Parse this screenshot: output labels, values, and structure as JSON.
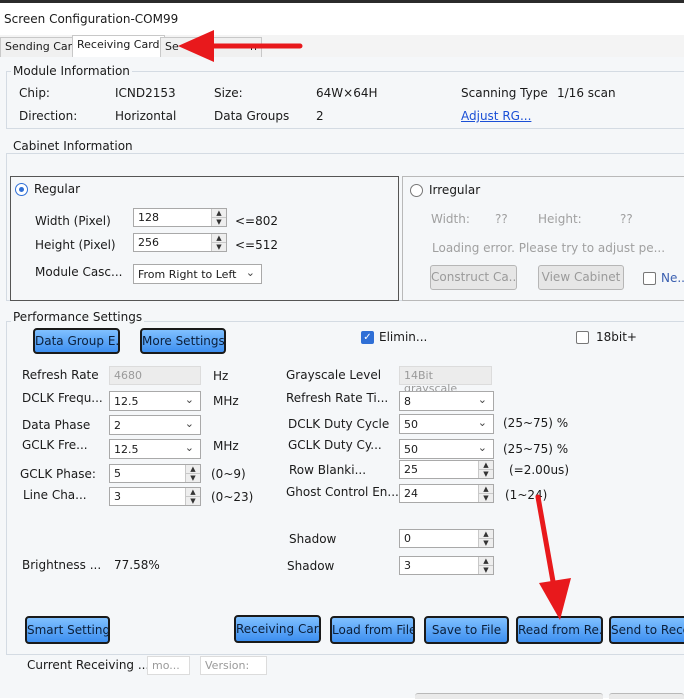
{
  "window": {
    "title": "Screen Configuration-COM99"
  },
  "tabs": [
    {
      "label": "Sending Card"
    },
    {
      "label": "Receiving Card"
    },
    {
      "label": "Se",
      "tail": "n"
    }
  ],
  "module_info": {
    "title": "Module Information",
    "chip_label": "Chip:",
    "chip_value": "ICND2153",
    "size_label": "Size:",
    "size_value": "64W×64H",
    "scanning_label": "Scanning Type",
    "scanning_value": "1/16 scan",
    "direction_label": "Direction:",
    "direction_value": "Horizontal",
    "data_groups_label": "Data Groups",
    "data_groups_value": "2",
    "adjust_link": "Adjust RG..."
  },
  "cabinet_info": {
    "title": "Cabinet Information",
    "regular_label": "Regular",
    "width_label": "Width (Pixel)",
    "width_value": "128",
    "width_limit": "<=802",
    "height_label": "Height (Pixel)",
    "height_value": "256",
    "height_limit": "<=512",
    "module_cascade_label": "Module Casc...",
    "module_cascade_value": "From Right to Left",
    "irregular_label": "Irregular",
    "irr_width_label": "Width:",
    "irr_width_value": "??",
    "irr_height_label": "Height:",
    "irr_height_value": "??",
    "loading_error": "Loading error. Please try to adjust pe...",
    "construct_btn": "Construct Ca...",
    "view_cabinet_btn": "View Cabinet",
    "ne_label": "Ne..."
  },
  "performance": {
    "title": "Performance Settings",
    "data_group_btn": "Data Group E...",
    "more_settings_btn": "More Settings",
    "elim_label": "Elimin...",
    "bit18_label": "18bit+",
    "refresh_rate_label": "Refresh Rate",
    "refresh_rate_value": "4680",
    "hz": "Hz",
    "dclk_freq_label": "DCLK Frequ...",
    "dclk_freq_value": "12.5",
    "mhz1": "MHz",
    "data_phase_label": "Data Phase",
    "data_phase_value": "2",
    "gclk_freq_label": "GCLK Fre...",
    "gclk_freq_value": "12.5",
    "mhz2": "MHz",
    "gclk_phase_label": "GCLK Phase:",
    "gclk_phase_value": "5",
    "gclk_phase_range": "(0~9)",
    "line_change_label": "Line Cha...",
    "line_change_value": "3",
    "line_change_range": "(0~23)",
    "grayscale_label": "Grayscale Level",
    "grayscale_value": "14Bit grayscale",
    "refresh_times_label": "Refresh Rate Ti...",
    "refresh_times_value": "8",
    "dclk_duty_label": "DCLK Duty Cycle",
    "dclk_duty_value": "50",
    "dclk_duty_range": "(25~75) %",
    "gclk_duty_label": "GCLK Duty Cy...",
    "gclk_duty_value": "50",
    "gclk_duty_range": "(25~75) %",
    "row_blank_label": "Row Blanki...",
    "row_blank_value": "25",
    "row_blank_note": "(=2.00us)",
    "ghost_label": "Ghost Control En...",
    "ghost_value": "24",
    "ghost_range": "(1~24)",
    "shadow1_label": "Shadow",
    "shadow1_value": "0",
    "shadow2_label": "Shadow",
    "shadow2_value": "3",
    "brightness_label": "Brightness ...",
    "brightness_value": "77.58%"
  },
  "footer": {
    "smart_settings": "Smart Settings",
    "receiving_card": "Receiving Car...",
    "load_file": "Load from File",
    "save_file": "Save to File",
    "read_from": "Read from Re...",
    "send_to": "Send to Rece",
    "current_label": "Current Receiving ...",
    "model_placeholder": "mo...",
    "version_placeholder": "Version:"
  },
  "colors": {
    "accent": "#2f6fd6",
    "button_blue": "#4a9bf5",
    "arrow_red": "#e8191c"
  }
}
